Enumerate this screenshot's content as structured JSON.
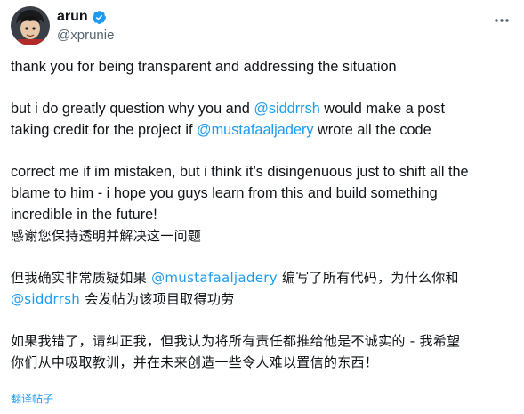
{
  "author": {
    "name": "arun",
    "handle": "@xprunie",
    "verified": true,
    "avatar_icon": "avatar-anime-character",
    "verified_color": "#1d9bf0"
  },
  "post": {
    "en_p1": "thank you for being transparent and addressing the situation",
    "en_p2_a": "but i do greatly question why you and ",
    "en_p2_m1": "@siddrrsh",
    "en_p2_b": " would make a post",
    "en_p2_c": "taking credit for the project if ",
    "en_p2_m2": "@mustafaaljadery",
    "en_p2_d": " wrote all the code",
    "en_p3_l1": "correct me if im mistaken, but i think it’s disingenuous just to shift all the",
    "en_p3_l2": "blame to him - i hope you guys learn from this and build something",
    "en_p3_l3": "incredible in the future!",
    "zh_p1": "感谢您保持透明并解决这一问题",
    "zh_p2_a": "但我确实非常质疑如果 ",
    "zh_p2_m1": "@mustafaaljadery",
    "zh_p2_b": " 编写了所有代码，为什么你和",
    "zh_p2_m2": "@siddrrsh",
    "zh_p2_c": " 会发帖为该项目取得功劳",
    "zh_p3_l1": "如果我错了，请纠正我，但我认为将所有责任都推给他是不诚实的 - 我希望",
    "zh_p3_l2": "你们从中吸取教训，并在未来创造一些令人难以置信的东西！"
  },
  "translate_label": "翻译帖子",
  "colors": {
    "link": "#1d9bf0",
    "muted": "#536471",
    "text": "#0f1419"
  }
}
